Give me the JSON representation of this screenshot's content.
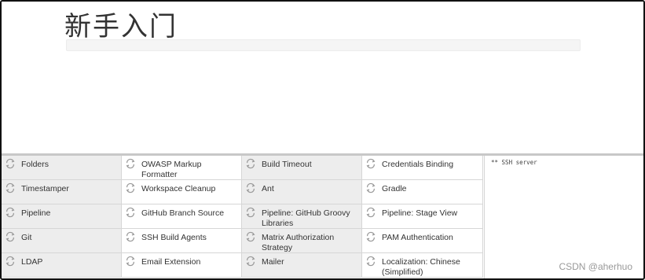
{
  "header": {
    "title": "新手入门"
  },
  "progress": {
    "fraction": 0
  },
  "plugins": [
    {
      "label": "Folders",
      "icon": "refresh-icon"
    },
    {
      "label": "OWASP Markup Formatter",
      "icon": "refresh-icon"
    },
    {
      "label": "Build Timeout",
      "icon": "refresh-icon"
    },
    {
      "label": "Credentials Binding",
      "icon": "refresh-icon"
    },
    {
      "label": "Timestamper",
      "icon": "refresh-icon"
    },
    {
      "label": "Workspace Cleanup",
      "icon": "refresh-icon"
    },
    {
      "label": "Ant",
      "icon": "refresh-icon"
    },
    {
      "label": "Gradle",
      "icon": "refresh-icon"
    },
    {
      "label": "Pipeline",
      "icon": "refresh-icon"
    },
    {
      "label": "GitHub Branch Source",
      "icon": "refresh-icon"
    },
    {
      "label": "Pipeline: GitHub Groovy Libraries",
      "icon": "refresh-icon"
    },
    {
      "label": "Pipeline: Stage View",
      "icon": "refresh-icon"
    },
    {
      "label": "Git",
      "icon": "refresh-icon"
    },
    {
      "label": "SSH Build Agents",
      "icon": "refresh-icon"
    },
    {
      "label": "Matrix Authorization Strategy",
      "icon": "refresh-icon"
    },
    {
      "label": "PAM Authentication",
      "icon": "refresh-icon"
    },
    {
      "label": "LDAP",
      "icon": "refresh-icon"
    },
    {
      "label": "Email Extension",
      "icon": "refresh-icon"
    },
    {
      "label": "Mailer",
      "icon": "refresh-icon"
    },
    {
      "label": "Localization: Chinese (Simplified)",
      "icon": "refresh-icon"
    }
  ],
  "log": {
    "text": "** SSH server"
  },
  "watermark": {
    "text": "CSDN @aherhuo"
  },
  "colors": {
    "icon": "#9a9a9a",
    "shade": "#ededed",
    "text": "#333333"
  }
}
